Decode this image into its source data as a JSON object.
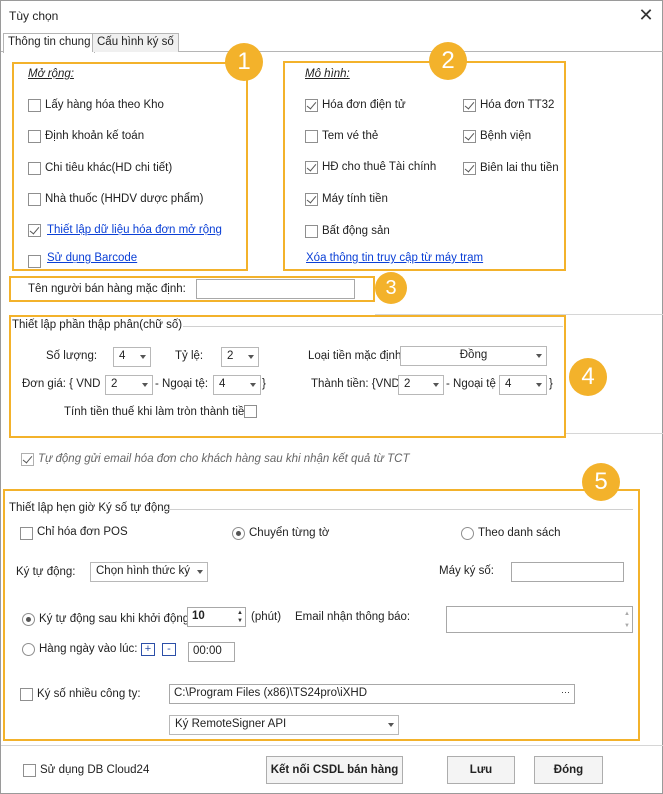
{
  "window": {
    "title": "Tùy chọn",
    "close": "✕"
  },
  "tabs": [
    {
      "label": "Thông tin chung"
    },
    {
      "label": "Cấu hình ký số"
    }
  ],
  "badges": [
    "1",
    "2",
    "3",
    "4",
    "5"
  ],
  "mo_rong": {
    "header": "Mở rộng:",
    "items": [
      {
        "label": "Lấy hàng hóa theo Kho",
        "checked": false
      },
      {
        "label": "Định khoản kế toán",
        "checked": false
      },
      {
        "label": "Chi tiêu khác(HD chi tiết)",
        "checked": false
      },
      {
        "label": "Nhà thuốc (HHDV dược phẩm)",
        "checked": false
      },
      {
        "label": "Thiết lập dữ liệu hóa đơn mở rộng",
        "checked": true
      },
      {
        "label": "Sử dụng Barcode",
        "checked": false
      }
    ]
  },
  "mo_hinh": {
    "header": "Mô hình:",
    "left": [
      {
        "label": "Hóa đơn điện tử",
        "checked": true
      },
      {
        "label": "Tem vé thẻ",
        "checked": false
      },
      {
        "label": "HĐ cho thuê Tài chính",
        "checked": true
      },
      {
        "label": "Máy tính tiền",
        "checked": true
      },
      {
        "label": "Bất động sản",
        "checked": false
      }
    ],
    "right": [
      {
        "label": "Hóa đơn TT32",
        "checked": true
      },
      {
        "label": "Bệnh viện",
        "checked": true
      },
      {
        "label": "Biên lai thu tiền",
        "checked": true
      }
    ],
    "link": "Xóa thông tin truy cập từ máy trạm"
  },
  "seller": {
    "label": "Tên người bán hàng mặc định:",
    "value": ""
  },
  "decimal": {
    "title": "Thiết lập phần thập phân(chữ số)",
    "so_luong_label": "Số lượng:",
    "so_luong": "4",
    "ty_le_label": "Tỷ lệ:",
    "ty_le": "2",
    "loai_tien_label": "Loại tiền mặc định:",
    "loai_tien": "Đồng",
    "don_gia_label": "Đơn giá: { VND",
    "don_gia_vnd": "2",
    "don_gia_nt_label": "- Ngoại tệ:",
    "don_gia_nt": "4",
    "close_brace": "}",
    "thanh_tien_label": "Thành tiền: {VND",
    "thanh_tien_vnd": "2",
    "thanh_tien_nt_label": "- Ngoại tệ",
    "thanh_tien_nt": "4",
    "tinh_tien_label": "Tính tiền thuế khi làm tròn thành tiền"
  },
  "auto_email": {
    "label": "Tự động gửi email hóa đơn cho khách hàng sau khi nhận kết quả từ TCT",
    "checked": true
  },
  "schedule": {
    "title": "Thiết lập hẹn giờ Ký số tự động",
    "chi_pos": "Chỉ hóa đơn POS",
    "chuyen_tung_to": "Chuyển từng tờ",
    "theo_danh_sach": "Theo danh sách",
    "ky_tu_dong_label": "Ký tự động:",
    "ky_tu_dong_value": "Chọn hình thức ký",
    "may_ky_so_label": "Máy ký số:",
    "may_ky_so_value": "",
    "sau_khoi_dong_label": "Ký tự động sau khi khởi động:",
    "minutes": "10",
    "phut": "(phút)",
    "email_label": "Email nhận thông báo:",
    "hang_ngay_label": "Hàng ngày vào lúc:",
    "plus": "+",
    "minus": "-",
    "time": "00:00",
    "nhieu_cong_ty_label": "Ký số nhiều công ty:",
    "path": "C:\\Program Files (x86)\\TS24pro\\iXHD",
    "browse": "···",
    "signer": "Ký RemoteSigner API"
  },
  "footer": {
    "cloud": "Sử dụng DB Cloud24",
    "connect": "Kết nối CSDL bán hàng",
    "save": "Lưu",
    "close": "Đóng"
  },
  "colors": {
    "accent": "#f3b22b",
    "link": "#0a3fd6"
  }
}
